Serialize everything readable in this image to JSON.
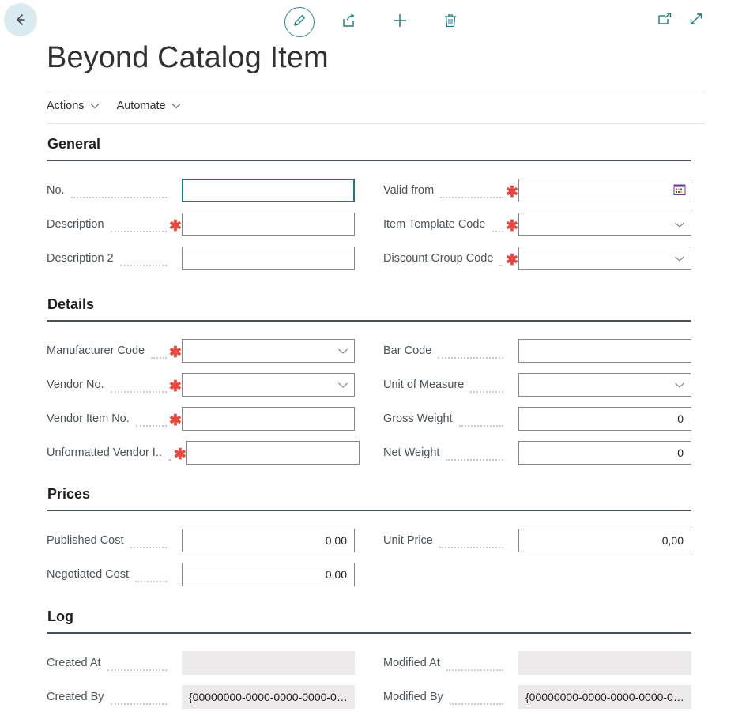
{
  "topbar": {
    "back_icon": "arrow-left-icon",
    "commands": [
      {
        "name": "edit",
        "icon": "pencil-icon",
        "circled": true
      },
      {
        "name": "share",
        "icon": "share-icon",
        "circled": false
      },
      {
        "name": "new",
        "icon": "plus-icon",
        "circled": false
      },
      {
        "name": "delete",
        "icon": "trash-icon",
        "circled": false
      }
    ],
    "right_commands": [
      {
        "name": "open-in-new-window",
        "icon": "open-new-window-icon"
      },
      {
        "name": "expand",
        "icon": "expand-diagonal-icon"
      }
    ]
  },
  "page": {
    "title": "Beyond Catalog Item"
  },
  "actions": [
    {
      "label": "Actions"
    },
    {
      "label": "Automate"
    }
  ],
  "sections": [
    {
      "title": "General",
      "left": [
        {
          "label": "No.",
          "value": "",
          "type": "text",
          "required": false,
          "focused": true
        },
        {
          "label": "Description",
          "value": "",
          "type": "text",
          "required": true,
          "focused": false
        },
        {
          "label": "Description 2",
          "value": "",
          "type": "text",
          "required": false,
          "focused": false
        }
      ],
      "right": [
        {
          "label": "Valid from",
          "value": "",
          "type": "date",
          "required": true,
          "focused": false
        },
        {
          "label": "Item Template Code",
          "value": "",
          "type": "select",
          "required": true,
          "focused": false
        },
        {
          "label": "Discount Group Code",
          "value": "",
          "type": "select",
          "required": true,
          "focused": false
        }
      ]
    },
    {
      "title": "Details",
      "left": [
        {
          "label": "Manufacturer Code",
          "value": "",
          "type": "select",
          "required": true,
          "focused": false
        },
        {
          "label": "Vendor No.",
          "value": "",
          "type": "select",
          "required": true,
          "focused": false
        },
        {
          "label": "Vendor Item No.",
          "value": "",
          "type": "text",
          "required": true,
          "focused": false
        },
        {
          "label": "Unformatted Vendor I..",
          "value": "",
          "type": "text",
          "required": true,
          "focused": false
        }
      ],
      "right": [
        {
          "label": "Bar Code",
          "value": "",
          "type": "text",
          "required": false,
          "focused": false
        },
        {
          "label": "Unit of Measure",
          "value": "",
          "type": "select",
          "required": false,
          "focused": false
        },
        {
          "label": "Gross Weight",
          "value": "0",
          "type": "number",
          "required": false,
          "focused": false
        },
        {
          "label": "Net Weight",
          "value": "0",
          "type": "number",
          "required": false,
          "focused": false
        }
      ]
    },
    {
      "title": "Prices",
      "left": [
        {
          "label": "Published Cost",
          "value": "0,00",
          "type": "number",
          "required": false,
          "focused": false
        },
        {
          "label": "Negotiated Cost",
          "value": "0,00",
          "type": "number",
          "required": false,
          "focused": false
        }
      ],
      "right": [
        {
          "label": "Unit Price",
          "value": "0,00",
          "type": "number",
          "required": false,
          "focused": false
        }
      ]
    },
    {
      "title": "Log",
      "left": [
        {
          "label": "Created At",
          "value": "",
          "type": "readonly",
          "required": false,
          "focused": false
        },
        {
          "label": "Created By",
          "value": "{00000000-0000-0000-0000-00...",
          "type": "readonly",
          "required": false,
          "focused": false
        }
      ],
      "right": [
        {
          "label": "Modified At",
          "value": "",
          "type": "readonly",
          "required": false,
          "focused": false
        },
        {
          "label": "Modified By",
          "value": "{00000000-0000-0000-0000-00...",
          "type": "readonly",
          "required": false,
          "focused": false
        }
      ]
    }
  ],
  "colors": {
    "accent_teal": "#1b7b84",
    "focus_border": "#107c84",
    "required_red": "#e8483c",
    "label_grey": "#4c5356",
    "section_rule": "#4b515c",
    "readonly_fill": "#eceaea",
    "back_circle": "#d9eaf0"
  }
}
